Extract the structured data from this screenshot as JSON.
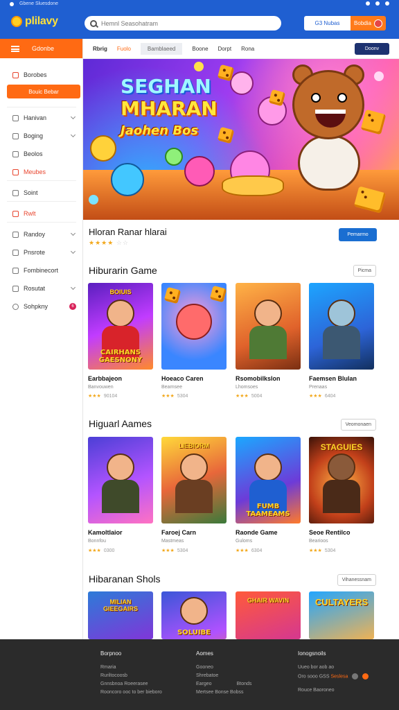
{
  "status": {
    "left": "Gbene  Sluesdone",
    "right_icons": [
      "location-icon",
      "wifi-icon",
      "battery-icon"
    ]
  },
  "header": {
    "logo": "plilavy",
    "search_placeholder": "Hemnl Seasohatram",
    "login_label": "G3  Nubas",
    "signup_label": "Bobdia"
  },
  "sidebar": {
    "menu_label": "Gdonbe",
    "section_label": "Borobes",
    "cta_label": "Bouic Bebar",
    "items": [
      {
        "label": "Hanivan",
        "chevron": true,
        "red": false
      },
      {
        "label": "Boging",
        "chevron": true,
        "red": false
      },
      {
        "label": "Beolos",
        "chevron": false,
        "red": false
      },
      {
        "label": "Meubes",
        "chevron": false,
        "red": true
      },
      {
        "label": "Soint",
        "chevron": false,
        "red": false
      },
      {
        "label": "Rwlt",
        "chevron": false,
        "red": true
      },
      {
        "label": "Randoy",
        "chevron": true,
        "red": false
      },
      {
        "label": "Pnsrote",
        "chevron": true,
        "red": false
      },
      {
        "label": "Fombinecort",
        "chevron": false,
        "red": false
      },
      {
        "label": "Rosutat",
        "chevron": true,
        "red": false
      },
      {
        "label": "Sohpkny",
        "chevron": false,
        "red": false,
        "badge": "6"
      }
    ]
  },
  "tabs": {
    "items": [
      "Rbrig",
      "Fuolo",
      "Bamblaeed",
      "Boone",
      "Dorpt",
      "Rona"
    ],
    "cta": "Doonv"
  },
  "hero": {
    "line1": "SEGHAN",
    "line2": "MHARAN",
    "line3": "Jaohen Bos"
  },
  "featured": {
    "title": "Hloran Ranar hlarai",
    "rating": 4,
    "play_label": "Pemarmo"
  },
  "sections": [
    {
      "title": "Hiburarin Game",
      "button": "Picma",
      "cards": [
        {
          "cover_top": "BOIUIS",
          "cover_text": "CAIRHANS GAESNONY",
          "name": "Earbbajeon",
          "sub": "Banvouwen",
          "rating": 3,
          "count": "90104"
        },
        {
          "cover_top": "",
          "cover_text": "",
          "name": "Hoeaco Caren",
          "sub": "Bearnsee",
          "rating": 3,
          "count": "5304"
        },
        {
          "cover_top": "",
          "cover_text": "",
          "name": "Rsomobilkslon",
          "sub": "Lhomsoes",
          "rating": 3,
          "count": "5004"
        },
        {
          "cover_top": "",
          "cover_text": "",
          "name": "Faemsen Blulan",
          "sub": "Prenaas",
          "rating": 3,
          "count": "6404"
        }
      ]
    },
    {
      "title": "Higuarl Aames",
      "button": "Veomonaen",
      "cards": [
        {
          "cover_top": "",
          "cover_text": "",
          "name": "Kamoltlaior",
          "sub": "Bonnfou",
          "rating": 3,
          "count": "0300"
        },
        {
          "cover_top": "LIEBIORM",
          "cover_text": "",
          "name": "Faroej Carn",
          "sub": "Mastmeas",
          "rating": 3,
          "count": "5304"
        },
        {
          "cover_top": "",
          "cover_text": "FUMB TAAMEAMS",
          "name": "Raonde Game",
          "sub": "Guloms",
          "rating": 3,
          "count": "6304"
        },
        {
          "cover_top": "STAGUIES",
          "cover_text": "",
          "name": "Seoe Rentilco",
          "sub": "Bearioos",
          "rating": 3,
          "count": "5304"
        }
      ]
    },
    {
      "title": "Hibaranan Shols",
      "button": "Vihanessnam",
      "cards": [
        {
          "cover_top": "MILIAN GIEEGAIRS",
          "cover_text": "",
          "name": "",
          "sub": "",
          "rating": 0,
          "count": ""
        },
        {
          "cover_top": "",
          "cover_text": "SOLUIBE",
          "name": "",
          "sub": "",
          "rating": 0,
          "count": ""
        },
        {
          "cover_top": "GHAIR WAVIN",
          "cover_text": "",
          "name": "",
          "sub": "",
          "rating": 0,
          "count": ""
        },
        {
          "cover_top": "CULTAYERS",
          "cover_text": "",
          "name": "",
          "sub": "",
          "rating": 0,
          "count": ""
        }
      ]
    }
  ],
  "footer": {
    "col1": {
      "title": "Borpnoo",
      "links": [
        "Rmaria",
        "Ruriltocoosb",
        "Gnnsbnoa  Roeerasee",
        "Rooncoro ooc to ber bieboro"
      ]
    },
    "col2": {
      "title": "Aomes",
      "links": [
        "Gooneo",
        "Shrebatoe",
        "Eargeo",
        "Mertsee Bonse Bobss"
      ],
      "extra": "Btonds"
    },
    "col3": {
      "title": "Ionogsnoils",
      "links": [
        "Uueo bor  aob ao",
        "Oro sooo  GSS",
        "Rouce Baoroneo"
      ],
      "highlight": "Seslesa"
    }
  },
  "colors": {
    "header_blue": "#1f5fd1",
    "accent_orange": "#ff6a13",
    "play_blue": "#1a6ed1",
    "footer_dark": "#2b2b2b"
  }
}
